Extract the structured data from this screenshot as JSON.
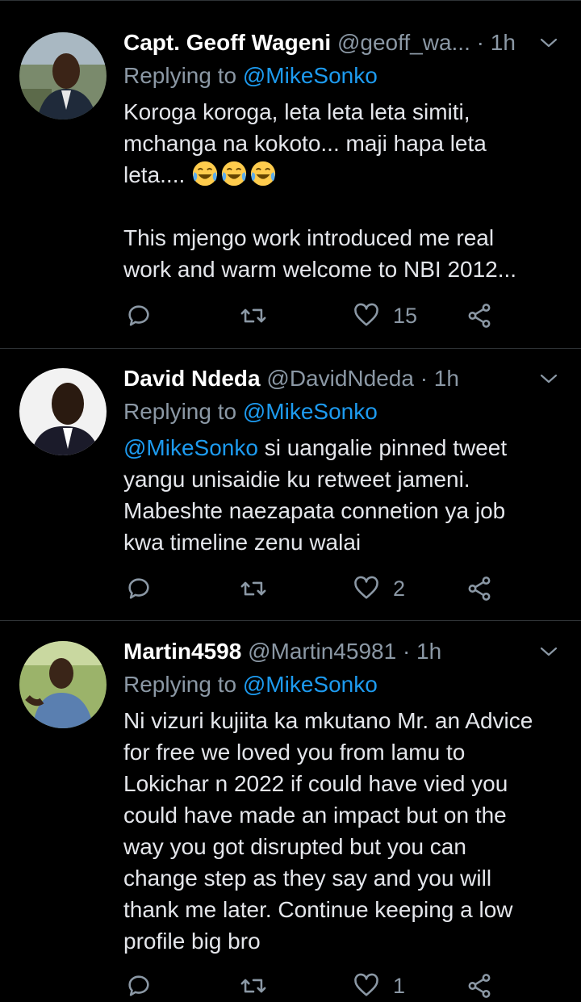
{
  "replying_prefix": "Replying to",
  "tweets": [
    {
      "name": "Capt. Geoff Wageni",
      "handle": "@geoff_wa...",
      "time": "· 1h",
      "reply_to": "@MikeSonko",
      "text_before_emoji": "Koroga koroga, leta leta leta simiti,\nmchanga na kokoto... maji hapa leta\nleta.... ",
      "emoji": [
        "face-with-tears-of-joy",
        "face-with-tears-of-joy",
        "face-with-tears-of-joy"
      ],
      "text_after_emoji": "\n\nThis mjengo work introduced me real\nwork and warm welcome to NBI 2012...",
      "likes": "15",
      "avatar_colors": {
        "bg": "#7a8a6c",
        "skin": "#3b2417",
        "shirt": "#1f2a3a"
      }
    },
    {
      "name": "David Ndeda",
      "handle": "@DavidNdeda",
      "time": "· 1h",
      "reply_to": "@MikeSonko",
      "mention": "@MikeSonko",
      "text": " si uangalie pinned tweet\nyangu unisaidie ku retweet jameni.\nMabeshte naezapata connetion ya job\nkwa timeline zenu walai",
      "likes": "2",
      "avatar_colors": {
        "bg": "#f2f2f2",
        "skin": "#2a1a10",
        "shirt": "#1b1b2a"
      }
    },
    {
      "name": "Martin4598",
      "handle": "@Martin45981",
      "time": "· 1h",
      "reply_to": "@MikeSonko",
      "text": "Ni vizuri kujiita ka mkutano Mr. an Advice\nfor free we loved you from lamu to\nLokichar n 2022 if could have vied you\ncould have made an impact but on the\nway you got disrupted but you can\nchange step as they say and you will\nthank me later. Continue keeping a low\nprofile big bro",
      "likes": "1",
      "avatar_colors": {
        "bg": "#9bb36a",
        "skin": "#3a2518",
        "shirt": "#5a7fb0"
      }
    }
  ],
  "colors": {
    "link": "#1d9bf0",
    "muted": "#8b98a5",
    "background": "#000000"
  }
}
